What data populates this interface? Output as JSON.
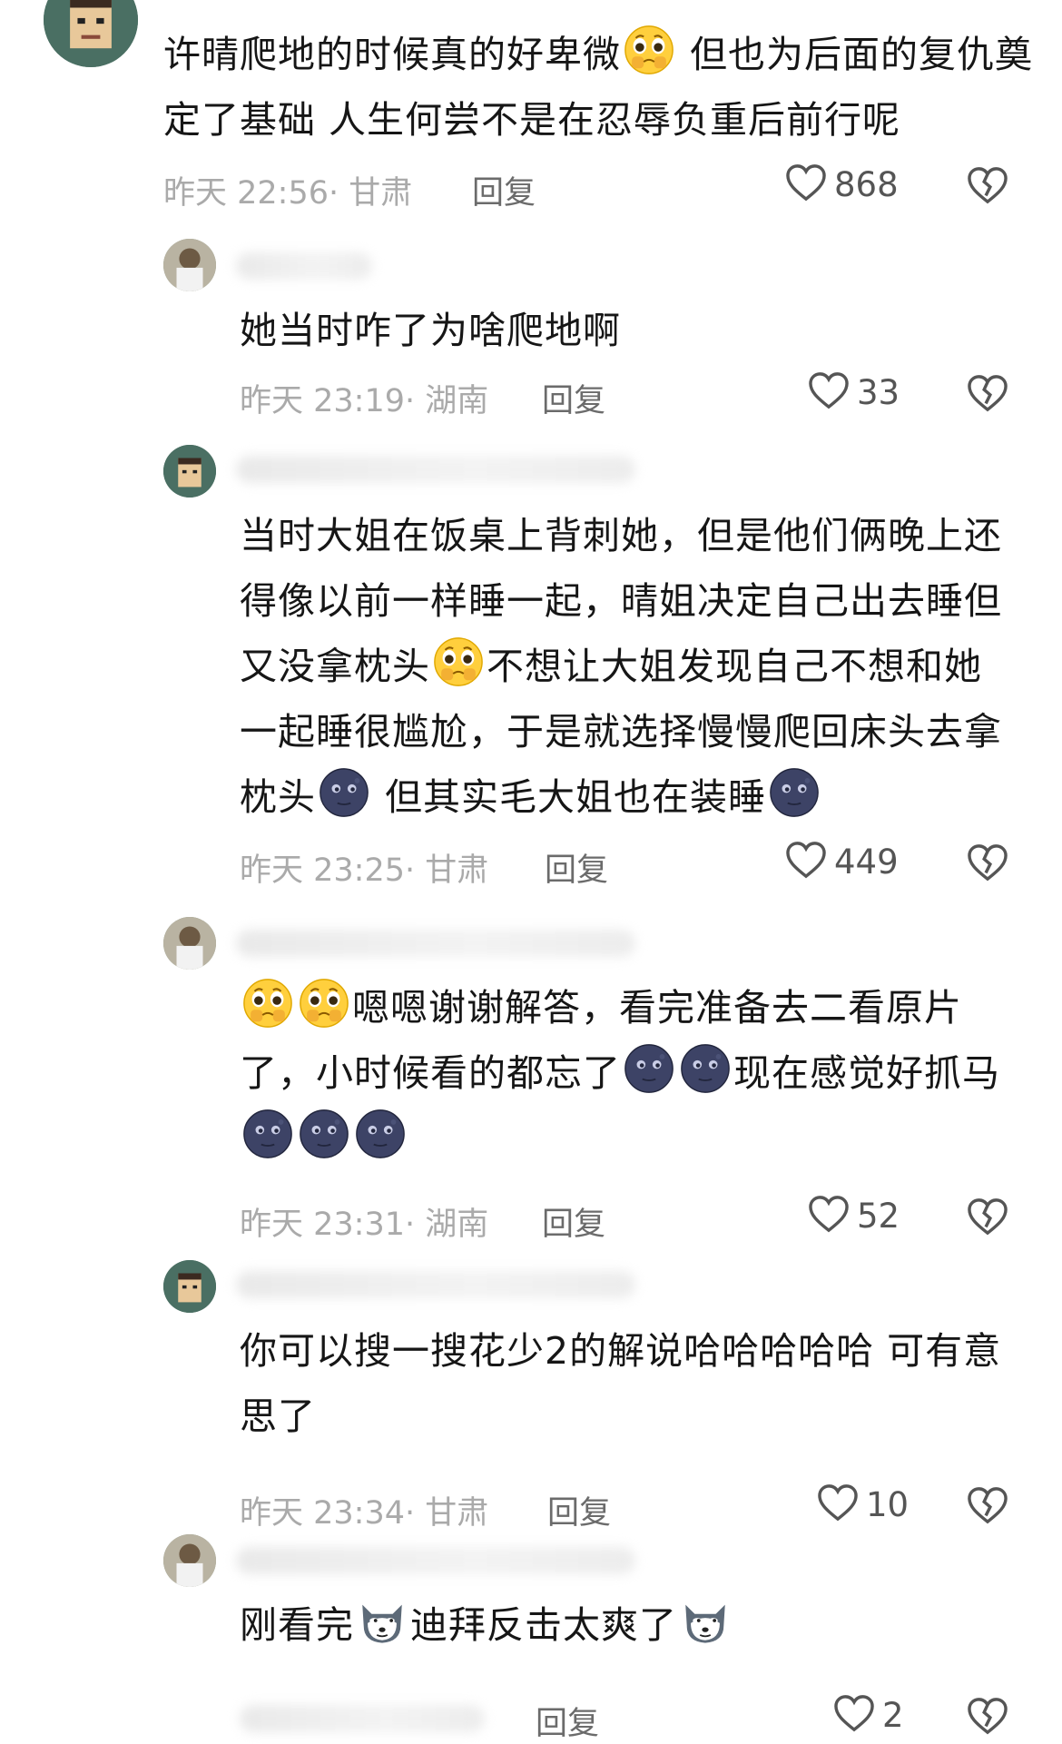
{
  "comments": [
    {
      "text": [
        "许晴爬地的时候真的好卑微",
        "emoji:cry",
        " 但也为后面的复仇奠定了基础 人生何尝不是在忍辱负重后前行呢"
      ],
      "time": "昨天 22:56",
      "location": "· 甘肃",
      "reply_label": "回复",
      "likes": "868"
    },
    {
      "text": [
        "她当时咋了为啥爬地啊"
      ],
      "time": "昨天 23:19",
      "location": "· 湖南",
      "reply_label": "回复",
      "likes": "33"
    },
    {
      "text": [
        "当时大姐在饭桌上背刺她，但是他们俩晚上还得像以前一样睡一起，晴姐决定自己出去睡但又没拿枕头",
        "emoji:cry",
        "不想让大姐发现自己不想和她一起睡很尴尬，于是就选择慢慢爬回床头去拿枕头",
        "emoji:moon",
        " 但其实毛大姐也在装睡",
        "emoji:moon"
      ],
      "time": "昨天 23:25",
      "location": "· 甘肃",
      "reply_label": "回复",
      "likes": "449"
    },
    {
      "text": [
        "emoji:cry",
        "emoji:cry",
        "嗯嗯谢谢解答，看完准备去二看原片了，小时候看的都忘了",
        "emoji:moon",
        "emoji:moon",
        "现在感觉好抓马",
        "emoji:moon",
        "emoji:moon",
        "emoji:moon"
      ],
      "time": "昨天 23:31",
      "location": "· 湖南",
      "reply_label": "回复",
      "likes": "52"
    },
    {
      "text": [
        "你可以搜一搜花少2的解说哈哈哈哈哈 可有意思了"
      ],
      "time": "昨天 23:34",
      "location": "· 甘肃",
      "reply_label": "回复",
      "likes": "10"
    },
    {
      "text": [
        "刚看完",
        "emoji:dog",
        "迪拜反击太爽了",
        "emoji:dog"
      ],
      "time": "",
      "location": "",
      "reply_label": "回复",
      "likes": "2"
    }
  ],
  "icons": {
    "like": "heart-outline-icon",
    "dislike": "broken-heart-icon",
    "emoji_cry": "pleading-face-emoji",
    "emoji_moon": "new-moon-face-emoji",
    "emoji_dog": "doge-emoji"
  },
  "colors": {
    "meta": "#aaaaaa",
    "text": "#161616",
    "icon": "#555555"
  }
}
